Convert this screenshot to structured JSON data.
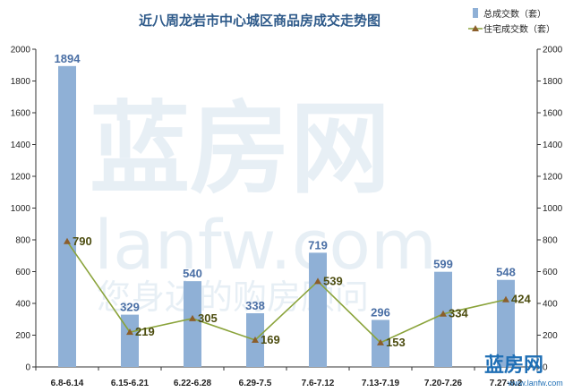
{
  "chart_data": {
    "type": "bar",
    "title": "近八周龙岩市中心城区商品房成交走势图",
    "categories": [
      "6.8-6.14",
      "6.15-6.21",
      "6.22-6.28",
      "6.29-7.5",
      "7.6-7.12",
      "7.13-7.19",
      "7.20-7.26",
      "7.27-8.2"
    ],
    "series": [
      {
        "name": "总成交数（套）",
        "type": "bar",
        "color": "#8fb0d6",
        "values": [
          1894,
          329,
          540,
          338,
          719,
          296,
          599,
          548
        ]
      },
      {
        "name": "住宅成交数（套）",
        "type": "line",
        "color": "#8aa33a",
        "marker_color": "#8b5e2b",
        "values": [
          790,
          219,
          305,
          169,
          539,
          153,
          334,
          424
        ]
      }
    ],
    "ylim": [
      0,
      2000
    ],
    "yticks": [
      0,
      200,
      400,
      600,
      800,
      1000,
      1200,
      1400,
      1600,
      1800,
      2000
    ],
    "secondary_ylim": [
      0,
      2000
    ],
    "grid": false,
    "legend_position": "top-right"
  },
  "watermark": {
    "line1": "蓝房网",
    "line2": "lanfw.com",
    "line3": "您身边的购房顾问"
  },
  "logo": {
    "name": "蓝房网",
    "url": "www.lanfw.com"
  }
}
